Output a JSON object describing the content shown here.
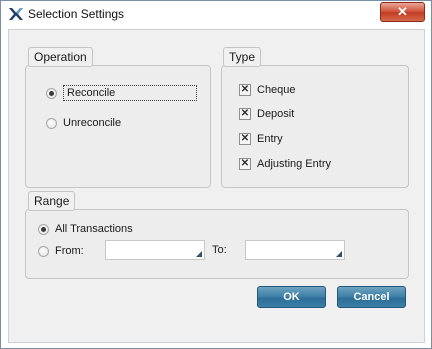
{
  "window": {
    "title": "Selection Settings",
    "close_label": "✕"
  },
  "operation": {
    "legend": "Operation",
    "options": [
      {
        "label": "Reconcile",
        "selected": true
      },
      {
        "label": "Unreconcile",
        "selected": false
      }
    ]
  },
  "type": {
    "legend": "Type",
    "options": [
      {
        "label": "Cheque",
        "checked": true
      },
      {
        "label": "Deposit",
        "checked": true
      },
      {
        "label": "Entry",
        "checked": true
      },
      {
        "label": "Adjusting Entry",
        "checked": true
      }
    ]
  },
  "range": {
    "legend": "Range",
    "all_label": "All Transactions",
    "all_selected": true,
    "from_label": "From:",
    "from_value": "",
    "to_label": "To:",
    "to_value": ""
  },
  "buttons": {
    "ok": "OK",
    "cancel": "Cancel"
  },
  "colors": {
    "button": "#3b7ea6",
    "close": "#c9472e",
    "brand": "#1f3f66"
  }
}
